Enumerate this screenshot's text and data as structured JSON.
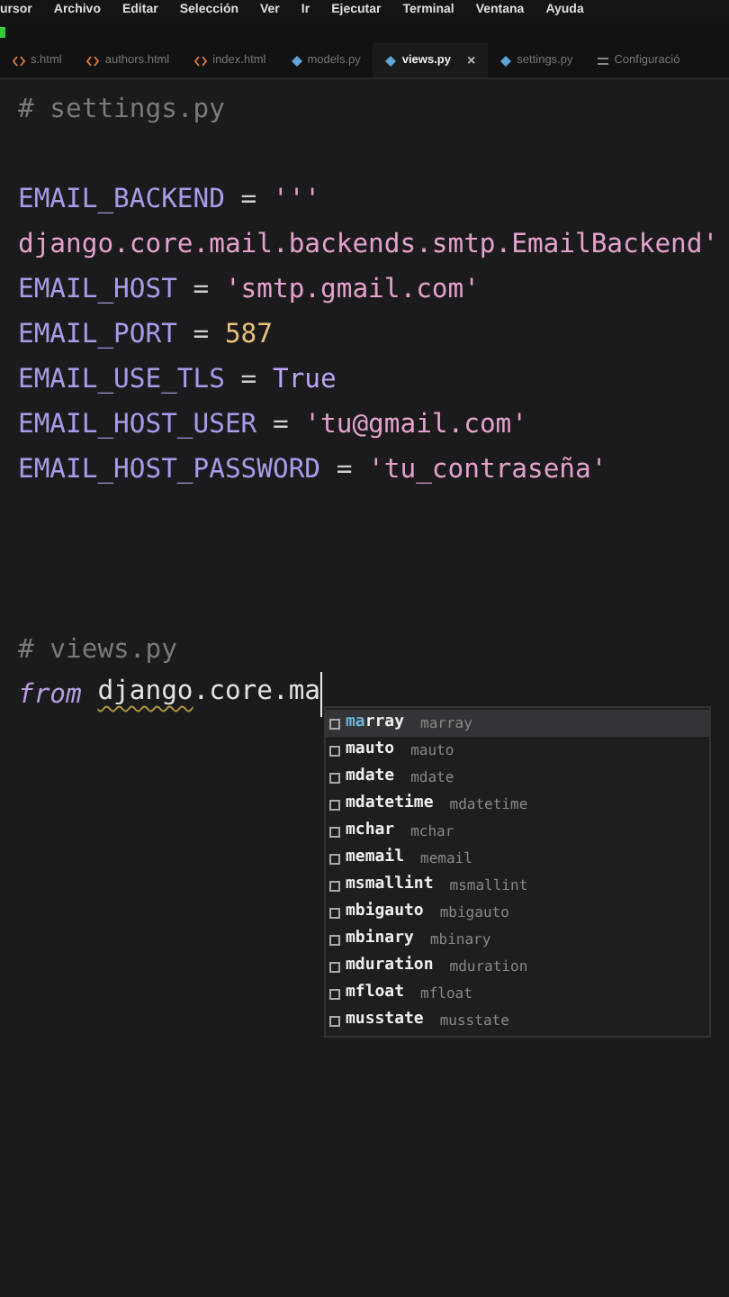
{
  "menu_bar": [
    "ursor",
    "Archivo",
    "Editar",
    "Selección",
    "Ver",
    "Ir",
    "Ejecutar",
    "Terminal",
    "Ventana",
    "Ayuda"
  ],
  "tabs": [
    {
      "label": "s.html",
      "kind": "html",
      "selected": false
    },
    {
      "label": "authors.html",
      "kind": "html",
      "selected": false
    },
    {
      "label": "index.html",
      "kind": "html",
      "selected": false
    },
    {
      "label": "models.py",
      "kind": "py",
      "selected": false
    },
    {
      "label": "views.py",
      "kind": "py",
      "selected": true,
      "close": "×"
    },
    {
      "label": "settings.py",
      "kind": "py",
      "selected": false
    },
    {
      "label": "Configuració",
      "kind": "settings",
      "selected": false
    }
  ],
  "code_lines": [
    {
      "kind": "code",
      "tokens": [
        {
          "kind": "comment",
          "text": "# settings.py"
        }
      ]
    },
    {
      "kind": "blank"
    },
    {
      "kind": "code",
      "tokens": [
        {
          "kind": "var",
          "text": "EMAIL_BACKEND"
        },
        {
          "kind": "op",
          "text": " = "
        },
        {
          "kind": "str",
          "text": "'''"
        }
      ]
    },
    {
      "kind": "code",
      "tokens": [
        {
          "kind": "str",
          "text": "django.core.mail.backends.smtp.EmailBackend'"
        }
      ]
    },
    {
      "kind": "code",
      "tokens": [
        {
          "kind": "var",
          "text": "EMAIL_HOST"
        },
        {
          "kind": "op",
          "text": " = "
        },
        {
          "kind": "str",
          "text": "'smtp.gmail.com'"
        }
      ]
    },
    {
      "kind": "code",
      "tokens": [
        {
          "kind": "var",
          "text": "EMAIL_PORT"
        },
        {
          "kind": "op",
          "text": " = "
        },
        {
          "kind": "num",
          "text": "587"
        }
      ]
    },
    {
      "kind": "code",
      "tokens": [
        {
          "kind": "var",
          "text": "EMAIL_USE_TLS"
        },
        {
          "kind": "op",
          "text": " = "
        },
        {
          "kind": "const",
          "text": "True"
        }
      ]
    },
    {
      "kind": "code",
      "tokens": [
        {
          "kind": "var",
          "text": "EMAIL_HOST_USER"
        },
        {
          "kind": "op",
          "text": " = "
        },
        {
          "kind": "str",
          "text": "'tu@gmail.com'"
        }
      ]
    },
    {
      "kind": "code",
      "tokens": [
        {
          "kind": "var",
          "text": "EMAIL_HOST_PASSWORD"
        },
        {
          "kind": "op",
          "text": " = "
        },
        {
          "kind": "str",
          "text": "'tu_contraseña'"
        }
      ]
    },
    {
      "kind": "blank"
    },
    {
      "kind": "blank"
    },
    {
      "kind": "blank"
    },
    {
      "kind": "code",
      "tokens": [
        {
          "kind": "comment",
          "text": "# views.py"
        }
      ]
    },
    {
      "kind": "code",
      "cursor": true,
      "tokens": [
        {
          "kind": "kw",
          "text": "from "
        },
        {
          "kind": "plain",
          "text": "django",
          "squiggle": true
        },
        {
          "kind": "plain",
          "text": ".core.ma",
          "squiggle": false
        }
      ]
    }
  ],
  "suggestions": [
    {
      "match": "ma",
      "label": "rray",
      "detail": "marray",
      "selected": true
    },
    {
      "label": "mauto",
      "detail": "mauto",
      "selected": false
    },
    {
      "label": "mdate",
      "detail": "mdate",
      "selected": false
    },
    {
      "label": "mdatetime",
      "detail": "mdatetime",
      "selected": false
    },
    {
      "label": "mchar",
      "detail": "mchar",
      "selected": false
    },
    {
      "label": "memail",
      "detail": "memail",
      "selected": false
    },
    {
      "label": "msmallint",
      "detail": "msmallint",
      "selected": false
    },
    {
      "label": "mbigauto",
      "detail": "mbigauto",
      "selected": false
    },
    {
      "label": "mbinary",
      "detail": "mbinary",
      "selected": false
    },
    {
      "label": "mduration",
      "detail": "mduration",
      "selected": false
    },
    {
      "label": "mfloat",
      "detail": "mfloat",
      "selected": false
    },
    {
      "label": "musstate",
      "detail": "musstate",
      "selected": false
    }
  ]
}
